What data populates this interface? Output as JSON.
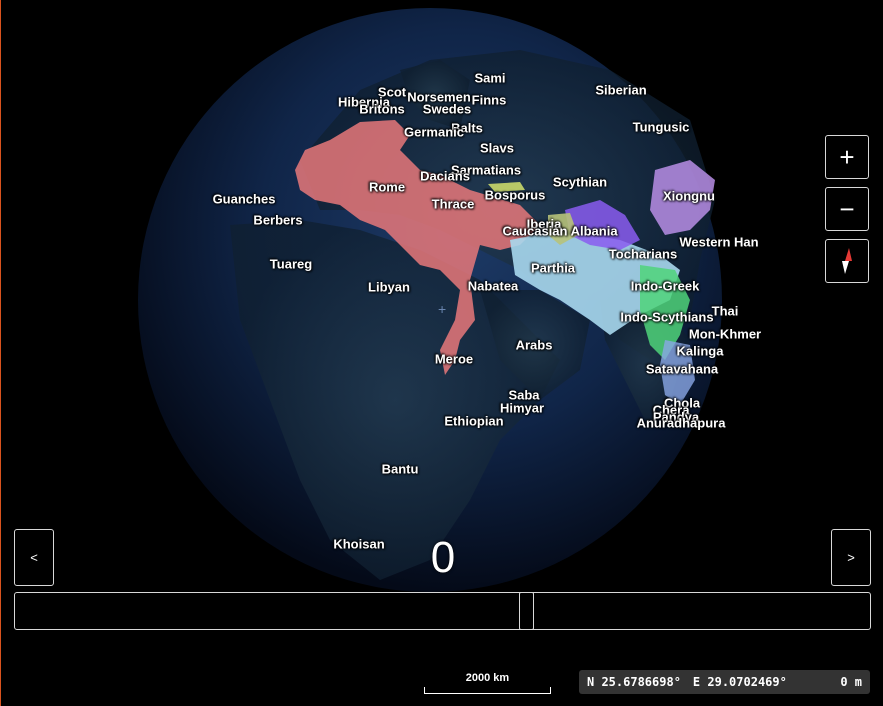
{
  "map": {
    "labels": [
      {
        "text": "Sami"
      },
      {
        "text": "Scot"
      },
      {
        "text": "Norsemen"
      },
      {
        "text": "Finns"
      },
      {
        "text": "Hibernia"
      },
      {
        "text": "Britons"
      },
      {
        "text": "Swedes"
      },
      {
        "text": "Siberian"
      },
      {
        "text": "Balts"
      },
      {
        "text": "Germanic"
      },
      {
        "text": "Tungusic"
      },
      {
        "text": "Slavs"
      },
      {
        "text": "Sarmatians"
      },
      {
        "text": "Dacians"
      },
      {
        "text": "Rome"
      },
      {
        "text": "Scythian"
      },
      {
        "text": "Xiongnu"
      },
      {
        "text": "Guanches"
      },
      {
        "text": "Bosporus"
      },
      {
        "text": "Thrace"
      },
      {
        "text": "Berbers"
      },
      {
        "text": "Iberia"
      },
      {
        "text": "Caucasian Albania"
      },
      {
        "text": "Western Han"
      },
      {
        "text": "Tocharians"
      },
      {
        "text": "Tuareg"
      },
      {
        "text": "Parthia"
      },
      {
        "text": "Libyan"
      },
      {
        "text": "Nabatea"
      },
      {
        "text": "Indo-Greek"
      },
      {
        "text": "Thai"
      },
      {
        "text": "Indo-Scythians"
      },
      {
        "text": "Mon-Khmer"
      },
      {
        "text": "Arabs"
      },
      {
        "text": "Kalinga"
      },
      {
        "text": "Meroe"
      },
      {
        "text": "Satavahana"
      },
      {
        "text": "Saba"
      },
      {
        "text": "Chola"
      },
      {
        "text": "Himyar"
      },
      {
        "text": "Chera"
      },
      {
        "text": "Pandya"
      },
      {
        "text": "Ethiopian"
      },
      {
        "text": "Anuradhapura"
      },
      {
        "text": "Bantu"
      },
      {
        "text": "Khoisan"
      }
    ],
    "colors": {
      "rome": "#e8787a",
      "parthia": "#a9d8ee",
      "xiongnu": "#b98ee6",
      "scythian_purple": "#8a5cf0",
      "indo_greek": "#4fd47a",
      "iberia": "#b7c27a",
      "bosporus": "#c9d86a",
      "satavahana": "#8aa7e6",
      "ocean": "#0f1f3c"
    }
  },
  "controls": {
    "zoom_in_label": "+",
    "zoom_out_label": "−",
    "compass_icon": "compass-icon",
    "prev_label": "<",
    "next_label": ">"
  },
  "timeline": {
    "year": "0",
    "position_fraction": 0.6
  },
  "scale": {
    "label": "2000 km"
  },
  "coords": {
    "lat": "N 25.6786698°",
    "lon": "E 29.0702469°",
    "elev": "0 m"
  }
}
